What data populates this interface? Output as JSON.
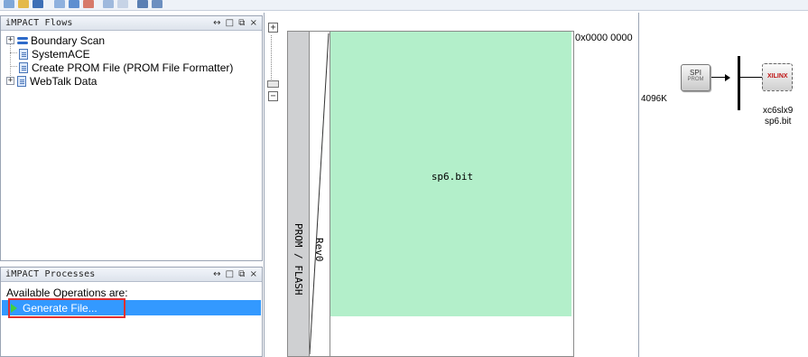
{
  "flows_panel": {
    "title": "iMPACT Flows",
    "controls": "↔ □ ⧉ ×",
    "items": [
      {
        "label": "Boundary Scan",
        "icon": "chain-icon",
        "expander": "+"
      },
      {
        "label": "SystemACE",
        "icon": "document-icon"
      },
      {
        "label": "Create PROM File (PROM File Formatter)",
        "icon": "document-icon"
      },
      {
        "label": "WebTalk Data",
        "icon": "document-icon",
        "expander": "+"
      }
    ]
  },
  "processes_panel": {
    "title": "iMPACT Processes",
    "controls": "↔ □ ⧉ ×",
    "available_label": "Available Operations are:",
    "operation_label": "Generate File..."
  },
  "zoom": {
    "plus": "+",
    "minus": "−"
  },
  "memory_map": {
    "prom_label": "PROM / FLASH",
    "revision_label": "Rev0",
    "block_label": "sp6.bit",
    "start_address": "0x0000 0000"
  },
  "diagram": {
    "prom_size": "4096K",
    "spi_label": "SPI",
    "spi_sublabel": "PROM",
    "fpga_logo": "XILINX",
    "fpga_part": "xc6slx9",
    "fpga_file": "sp6.bit"
  },
  "colors": {
    "selection": "#3399ff",
    "highlight_box": "#e03030",
    "bitstream_block": "#b3efca",
    "run_arrow": "#3fcf3f"
  }
}
